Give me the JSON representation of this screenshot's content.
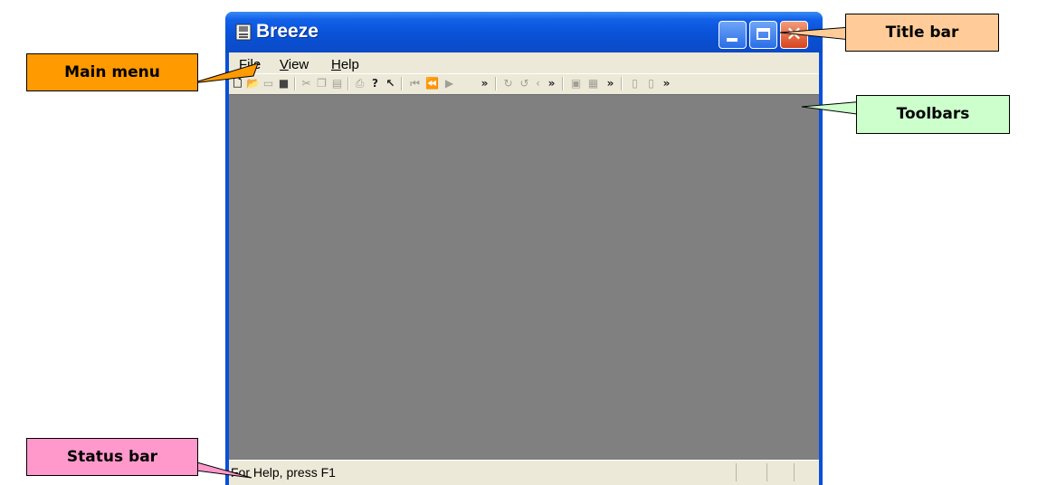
{
  "window": {
    "title": "Breeze",
    "close_glyph": "✕"
  },
  "menu": {
    "items": [
      {
        "mnemonic": "F",
        "rest": "ile"
      },
      {
        "mnemonic": "V",
        "rest": "iew"
      },
      {
        "mnemonic": "H",
        "rest": "elp"
      }
    ]
  },
  "toolbar": {
    "glyphs": {
      "new": "🗋",
      "open": "📂",
      "cut": "✂",
      "help_context": "?",
      "first": "⏮",
      "prev": "⏪",
      "next": "▶",
      "overflow": "»",
      "redo": "↻",
      "undo": "↺",
      "less": "‹"
    }
  },
  "status": {
    "text": "For Help, press F1"
  },
  "annotations": {
    "main_menu": "Main menu",
    "title_bar": "Title bar",
    "toolbars": "Toolbars",
    "status_bar": "Status bar"
  },
  "colors": {
    "titlebar": "#0A52D8",
    "workspace": "#808080",
    "chrome": "#ECE9D8",
    "callout_main_menu": "#FF9A00",
    "callout_title_bar": "#FFCC99",
    "callout_toolbars": "#CCFFCC",
    "callout_status_bar": "#FF99CC"
  }
}
